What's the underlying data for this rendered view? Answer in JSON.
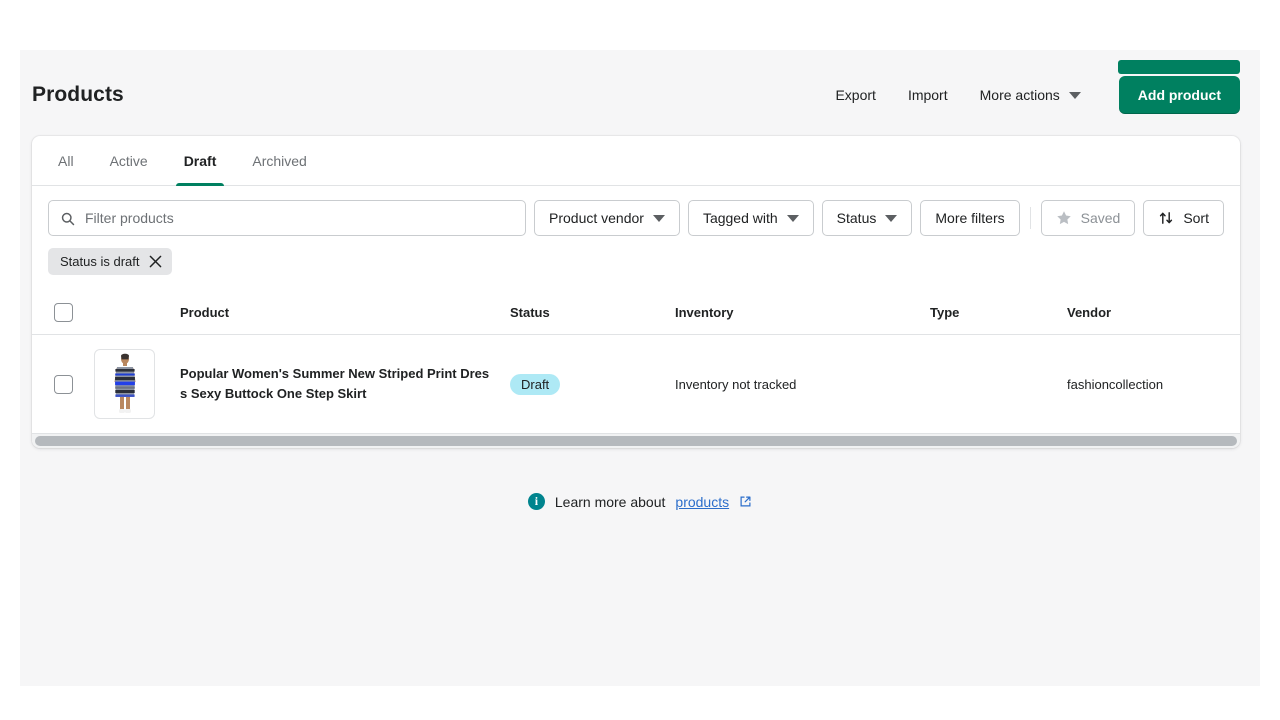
{
  "header": {
    "title": "Products",
    "actions": {
      "export_label": "Export",
      "import_label": "Import",
      "more_actions_label": "More actions",
      "add_product_label": "Add product"
    }
  },
  "tabs": [
    {
      "label": "All",
      "selected": false
    },
    {
      "label": "Active",
      "selected": false
    },
    {
      "label": "Draft",
      "selected": true
    },
    {
      "label": "Archived",
      "selected": false
    }
  ],
  "filters": {
    "search": {
      "value": "",
      "placeholder": "Filter products"
    },
    "buttons": [
      {
        "label": "Product vendor",
        "has_chevron": true
      },
      {
        "label": "Tagged with",
        "has_chevron": true
      },
      {
        "label": "Status",
        "has_chevron": true
      },
      {
        "label": "More filters",
        "has_chevron": false
      }
    ],
    "saved_label": "Saved",
    "sort_label": "Sort",
    "applied": [
      {
        "label": "Status is draft"
      }
    ]
  },
  "table": {
    "columns": [
      "Product",
      "Status",
      "Inventory",
      "Type",
      "Vendor"
    ],
    "rows": [
      {
        "title": "Popular Women's Summer New Striped Print Dress Sexy Buttock One Step Skirt",
        "status": "Draft",
        "inventory": "Inventory not tracked",
        "type": "",
        "vendor": "fashioncollection"
      }
    ]
  },
  "footer": {
    "text_before": "Learn more about",
    "link_label": "products"
  },
  "colors": {
    "brand_green": "#008060",
    "badge_blue": "#aee9f5",
    "link_blue": "#2c6ecb",
    "info_teal": "#00848e",
    "page_bg": "#f6f6f7"
  }
}
